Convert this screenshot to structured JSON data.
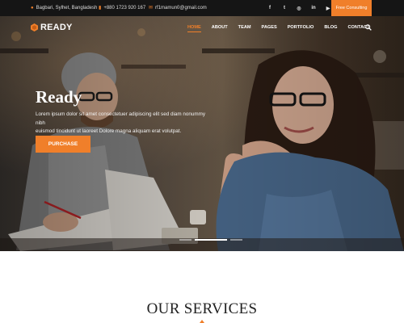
{
  "topbar": {
    "address": "Bagbari, Sylhet, Bangladesh",
    "phone": "+880 1723 920 167",
    "email": "rf1mamun0@gmail.com",
    "social_icons": [
      "facebook-icon",
      "twitter-icon",
      "instagram-icon",
      "linkedin-icon",
      "youtube-icon"
    ],
    "social_glyphs": [
      "f",
      "t",
      "◎",
      "in",
      "▶"
    ],
    "consult_label": "Free Consulting"
  },
  "nav": {
    "logo_text": "READY",
    "items": [
      {
        "label": "HOME",
        "active": true
      },
      {
        "label": "ABOUT",
        "active": false
      },
      {
        "label": "TEAM",
        "active": false
      },
      {
        "label": "PAGES",
        "active": false
      },
      {
        "label": "PORTFOLIO",
        "active": false
      },
      {
        "label": "BLOG",
        "active": false
      },
      {
        "label": "CONTACT",
        "active": false
      }
    ]
  },
  "hero": {
    "title": "Ready",
    "text_line1": "Lorem ipsum dolor sit amet consectetuer adipiscing elit sed diam nonummy nibh",
    "text_line2": "euismod tincidunt ut laoreet Dolore magna aliquam erat volutpat.",
    "button_label": "PURCHASE",
    "slides_total": 3,
    "active_slide": 2
  },
  "services": {
    "title": "OUR SERVICES"
  },
  "colors": {
    "accent": "#f07f2a",
    "topbar_bg": "#151515",
    "heading": "#222222"
  }
}
